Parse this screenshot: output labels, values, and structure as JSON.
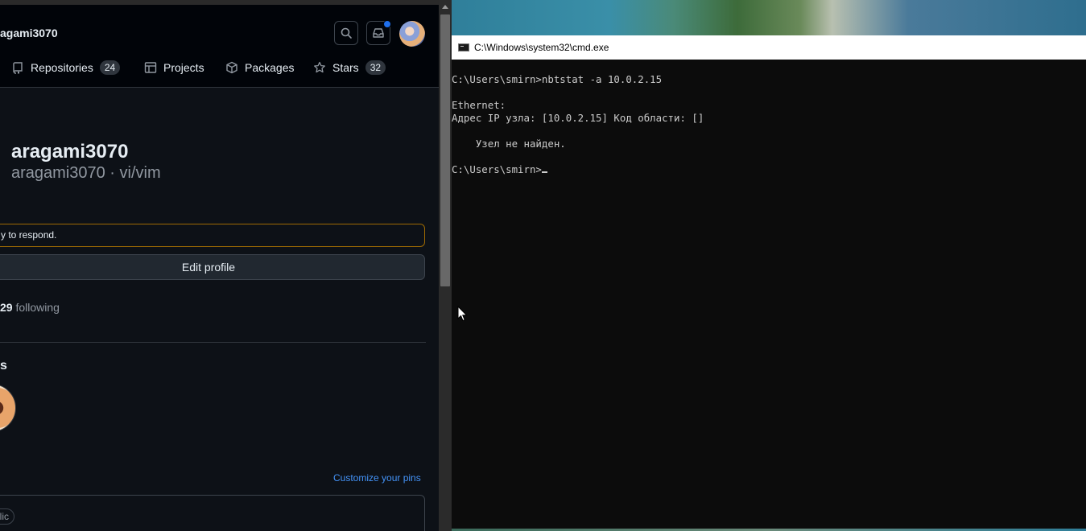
{
  "github": {
    "header": {
      "username": "agami3070"
    },
    "nav": {
      "items": [
        {
          "label": "Repositories",
          "count": "24"
        },
        {
          "label": "Projects"
        },
        {
          "label": "Packages"
        },
        {
          "label": "Stars",
          "count": "32"
        }
      ]
    },
    "profile": {
      "display_name": "aragami3070",
      "subtitle": "aragami3070 · vi/vim",
      "notice": "y to respond.",
      "edit_button": "Edit profile",
      "following_count": "29",
      "following_label": "following",
      "section_heading": "s"
    },
    "pins": {
      "customize_link": "Customize your pins",
      "visibility_label": "blic"
    }
  },
  "cmd": {
    "title": "C:\\Windows\\system32\\cmd.exe",
    "lines": [
      "C:\\Users\\smirn>nbtstat -a 10.0.2.15",
      "Ethernet:",
      "Адрес IP узла: [10.0.2.15] Код области: []",
      "    Узел не найден.",
      "C:\\Users\\smirn>"
    ]
  },
  "colors": {
    "accent_link": "#4493f8",
    "notice_border": "#9e6a03",
    "notification_dot": "#1f6feb"
  }
}
